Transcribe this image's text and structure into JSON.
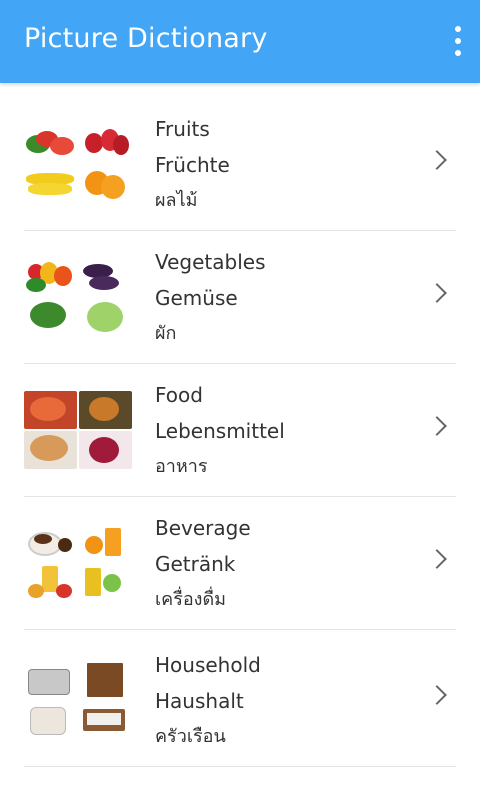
{
  "appbar": {
    "title": "Picture Dictionary",
    "menu_icon": "overflow-menu-icon"
  },
  "categories": [
    {
      "en": "Fruits",
      "de": "Früchte",
      "th": "ผลไม้"
    },
    {
      "en": "Vegetables",
      "de": "Gemüse",
      "th": "ผัก"
    },
    {
      "en": "Food",
      "de": "Lebensmittel",
      "th": "อาหาร"
    },
    {
      "en": "Beverage",
      "de": "Getränk",
      "th": "เครื่องดื่ม"
    },
    {
      "en": "Household",
      "de": "Haushalt",
      "th": "ครัวเรือน"
    }
  ],
  "colors": {
    "appbar": "#42A5F5",
    "divider": "#e4e4e4",
    "text": "#333333"
  }
}
